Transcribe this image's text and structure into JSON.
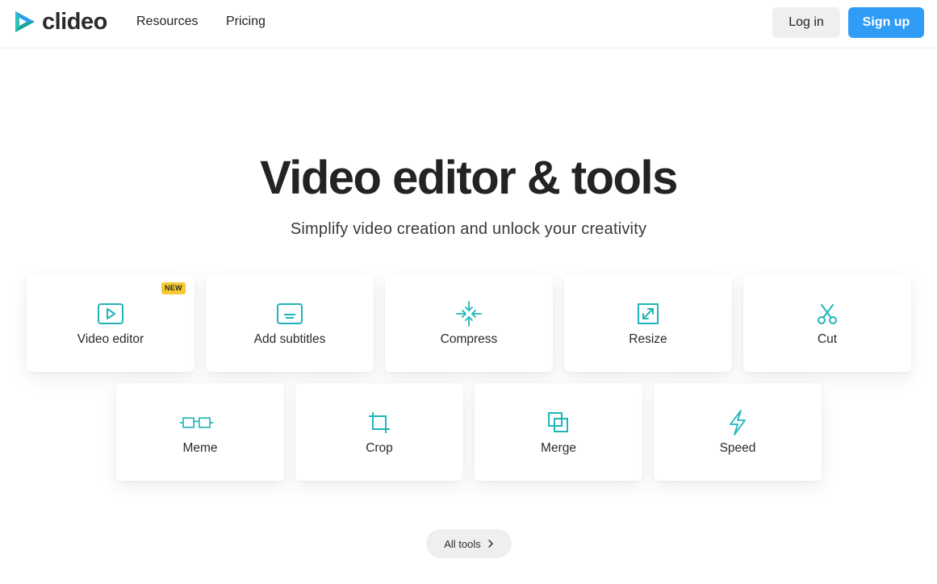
{
  "header": {
    "logo_text": "clideo",
    "nav": [
      {
        "label": "Resources"
      },
      {
        "label": "Pricing"
      }
    ],
    "login_label": "Log in",
    "signup_label": "Sign up"
  },
  "hero": {
    "title": "Video editor & tools",
    "subtitle": "Simplify video creation and unlock your creativity"
  },
  "tools": [
    {
      "label": "Video editor",
      "icon": "play-video-icon",
      "badge": "NEW"
    },
    {
      "label": "Add subtitles",
      "icon": "subtitles-icon"
    },
    {
      "label": "Compress",
      "icon": "compress-icon"
    },
    {
      "label": "Resize",
      "icon": "resize-icon"
    },
    {
      "label": "Cut",
      "icon": "scissors-icon"
    },
    {
      "label": "Meme",
      "icon": "glasses-icon"
    },
    {
      "label": "Crop",
      "icon": "crop-icon"
    },
    {
      "label": "Merge",
      "icon": "merge-icon"
    },
    {
      "label": "Speed",
      "icon": "lightning-icon"
    }
  ],
  "all_tools_label": "All tools",
  "colors": {
    "accent": "#2f9cf5",
    "icon": "#1fb5b8",
    "badge": "#f8ca32"
  }
}
